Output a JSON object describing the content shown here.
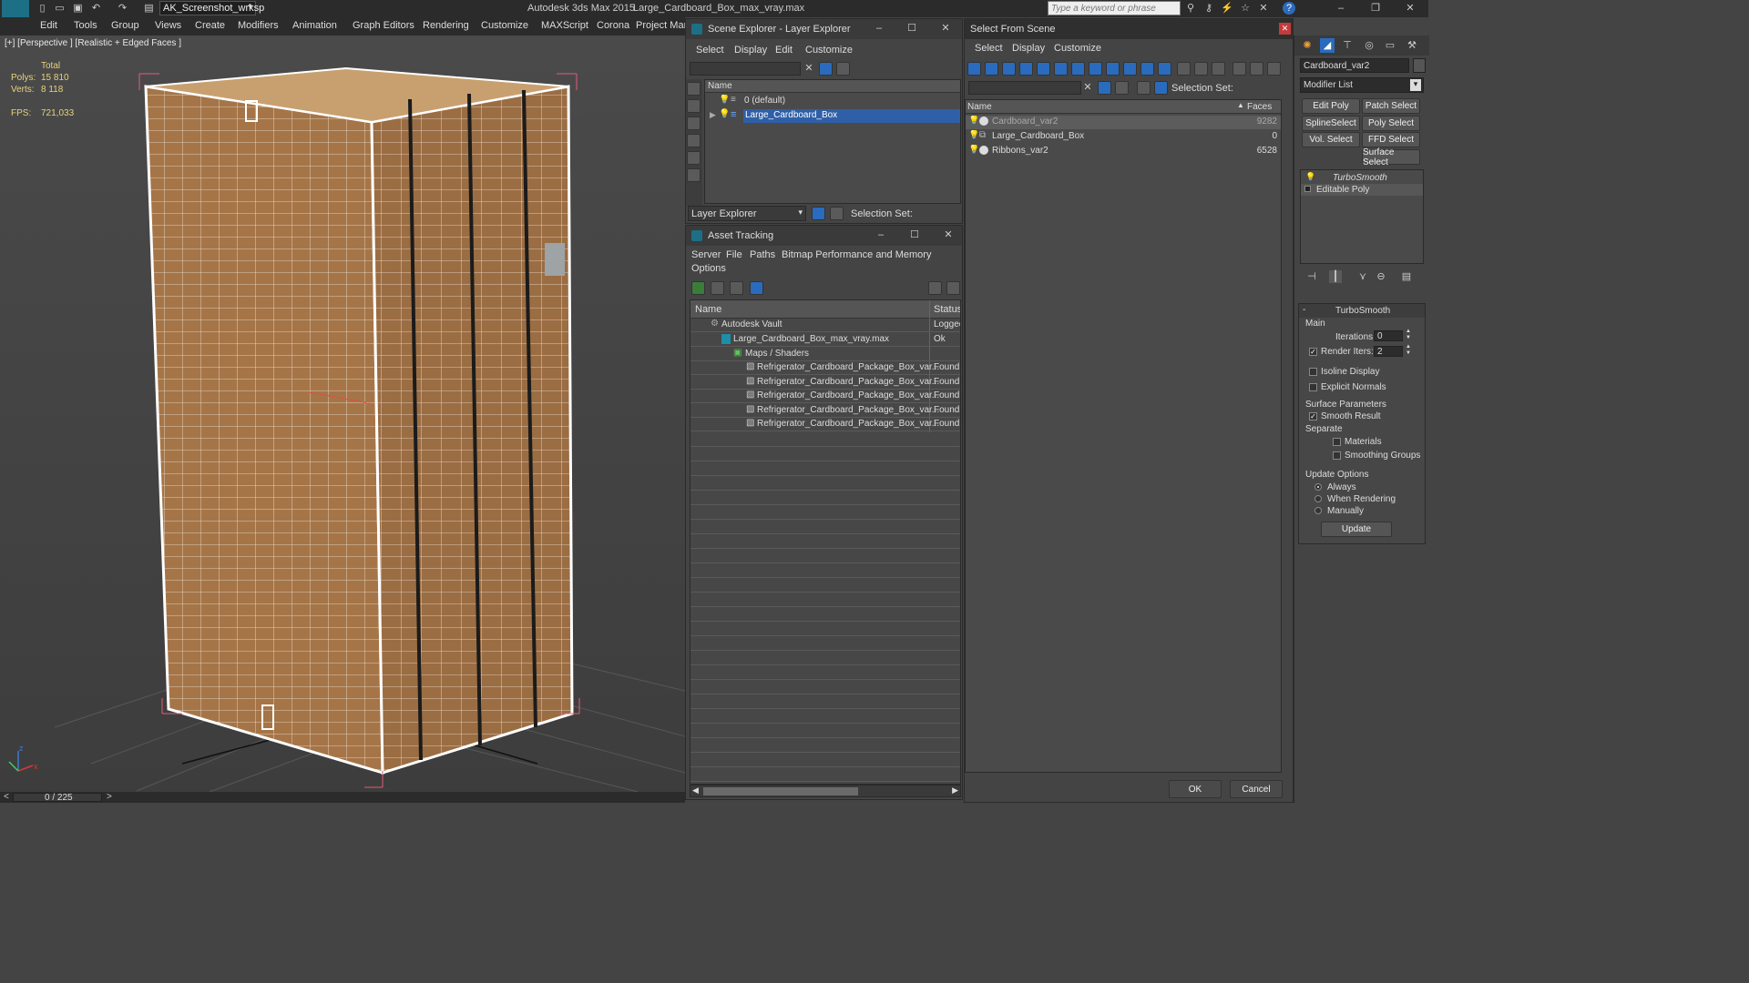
{
  "titlebar": {
    "app_title": "Autodesk 3ds Max  2015",
    "file_title": "Large_Cardboard_Box_max_vray.max",
    "workspace": "AK_Screenshot_wrksp",
    "search_placeholder": "Type a keyword or phrase"
  },
  "menu": [
    "Edit",
    "Tools",
    "Group",
    "Views",
    "Create",
    "Modifiers",
    "Animation",
    "Graph Editors",
    "Rendering",
    "Customize",
    "MAXScript",
    "Corona",
    "Project Man"
  ],
  "viewport": {
    "label": "[+] [Perspective ] [Realistic + Edged Faces ]",
    "stats": {
      "total_label": "Total",
      "polys_label": "Polys:",
      "polys": "15 810",
      "verts_label": "Verts:",
      "verts": "8 118",
      "fps_label": "FPS:",
      "fps": "721,033"
    }
  },
  "timeline": {
    "frame": "0 / 225",
    "prev": "<",
    "next": ">"
  },
  "layer_explorer": {
    "title": "Scene Explorer - Layer Explorer",
    "menu": [
      "Select",
      "Display",
      "Edit",
      "Customize"
    ],
    "column": "Name",
    "rows": [
      "0 (default)",
      "Large_Cardboard_Box"
    ],
    "footer_dropdown": "Layer Explorer",
    "selection_set": "Selection Set:"
  },
  "asset_tracking": {
    "title": "Asset Tracking",
    "menu": [
      "Server",
      "File",
      "Paths",
      "Bitmap Performance and Memory"
    ],
    "menu2": "Options",
    "col_name": "Name",
    "col_status": "Status",
    "rows": [
      {
        "name": "Autodesk Vault",
        "status": "Loggec"
      },
      {
        "name": "Large_Cardboard_Box_max_vray.max",
        "status": "Ok"
      },
      {
        "name": "Maps / Shaders",
        "status": ""
      },
      {
        "name": "Refrigerator_Cardboard_Package_Box_var...",
        "status": "Found"
      },
      {
        "name": "Refrigerator_Cardboard_Package_Box_var...",
        "status": "Found"
      },
      {
        "name": "Refrigerator_Cardboard_Package_Box_var...",
        "status": "Found"
      },
      {
        "name": "Refrigerator_Cardboard_Package_Box_var...",
        "status": "Found"
      },
      {
        "name": "Refrigerator_Cardboard_Package_Box_var...",
        "status": "Found"
      }
    ]
  },
  "select_from_scene": {
    "title": "Select From Scene",
    "menu": [
      "Select",
      "Display",
      "Customize"
    ],
    "selection_set": "Selection Set:",
    "col_name": "Name",
    "col_faces": "Faces",
    "rows": [
      {
        "name": "Cardboard_var2",
        "faces": "9282"
      },
      {
        "name": "Large_Cardboard_Box",
        "faces": "0"
      },
      {
        "name": "Ribbons_var2",
        "faces": "6528"
      }
    ],
    "ok": "OK",
    "cancel": "Cancel"
  },
  "command_panel": {
    "object_name": "Cardboard_var2",
    "modifier_list": "Modifier List",
    "buttons": [
      "Edit Poly",
      "Patch Select",
      "SplineSelect",
      "Poly Select",
      "Vol. Select",
      "FFD Select",
      "Surface Select"
    ],
    "stack": [
      "TurboSmooth",
      "Editable Poly"
    ],
    "rollout_title": "TurboSmooth",
    "main_label": "Main",
    "iterations_label": "Iterations:",
    "iterations": "0",
    "render_iters_label": "Render Iters:",
    "render_iters": "2",
    "isoline": "Isoline Display",
    "explicit_normals": "Explicit Normals",
    "surface_params": "Surface Parameters",
    "smooth_result": "Smooth Result",
    "separate": "Separate",
    "materials": "Materials",
    "smoothing_groups": "Smoothing Groups",
    "update_options": "Update Options",
    "always": "Always",
    "when_rendering": "When Rendering",
    "manually": "Manually",
    "update_button": "Update"
  }
}
